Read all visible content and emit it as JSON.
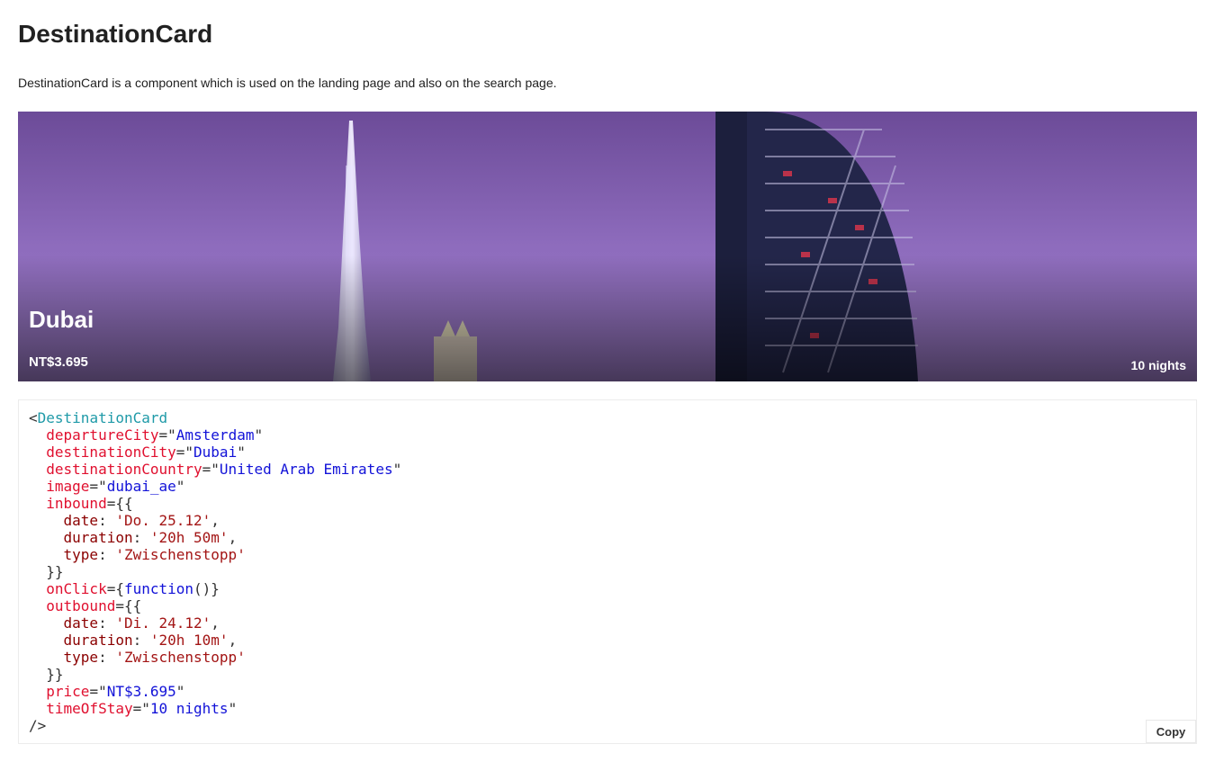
{
  "page": {
    "title": "DestinationCard",
    "description": "DestinationCard is a component which is used on the landing page and also on the search page."
  },
  "card": {
    "city": "Dubai",
    "price": "NT$3.695",
    "nights": "10 nights"
  },
  "code": {
    "open": "<",
    "component": "DestinationCard",
    "attrs": {
      "departureCity": "departureCity",
      "departureCity_value": "Amsterdam",
      "destinationCity": "destinationCity",
      "destinationCity_value": "Dubai",
      "destinationCountry": "destinationCountry",
      "destinationCountry_value": "United Arab Emirates",
      "image": "image",
      "image_value": "dubai_ae",
      "inbound": "inbound",
      "onClick": "onClick",
      "onClick_value": "function",
      "outbound": "outbound",
      "price": "price",
      "price_value": "NT$3.695",
      "timeOfStay": "timeOfStay",
      "timeOfStay_value": "10 nights"
    },
    "inbound": {
      "date_key": "date",
      "date": "'Do. 25.12'",
      "duration_key": "duration",
      "duration": "'20h 50m'",
      "type_key": "type",
      "type": "'Zwischenstopp'"
    },
    "outbound": {
      "date_key": "date",
      "date": "'Di. 24.12'",
      "duration_key": "duration",
      "duration": "'20h 10m'",
      "type_key": "type",
      "type": "'Zwischenstopp'"
    },
    "close": "/>",
    "copy_label": "Copy"
  },
  "colors": {
    "tag": "#1f9aa8",
    "attr": "#e0102f",
    "string": "#1212d8",
    "js_key": "#8b0000",
    "js_string": "#a31515",
    "card_sky": "#8a66b8"
  }
}
